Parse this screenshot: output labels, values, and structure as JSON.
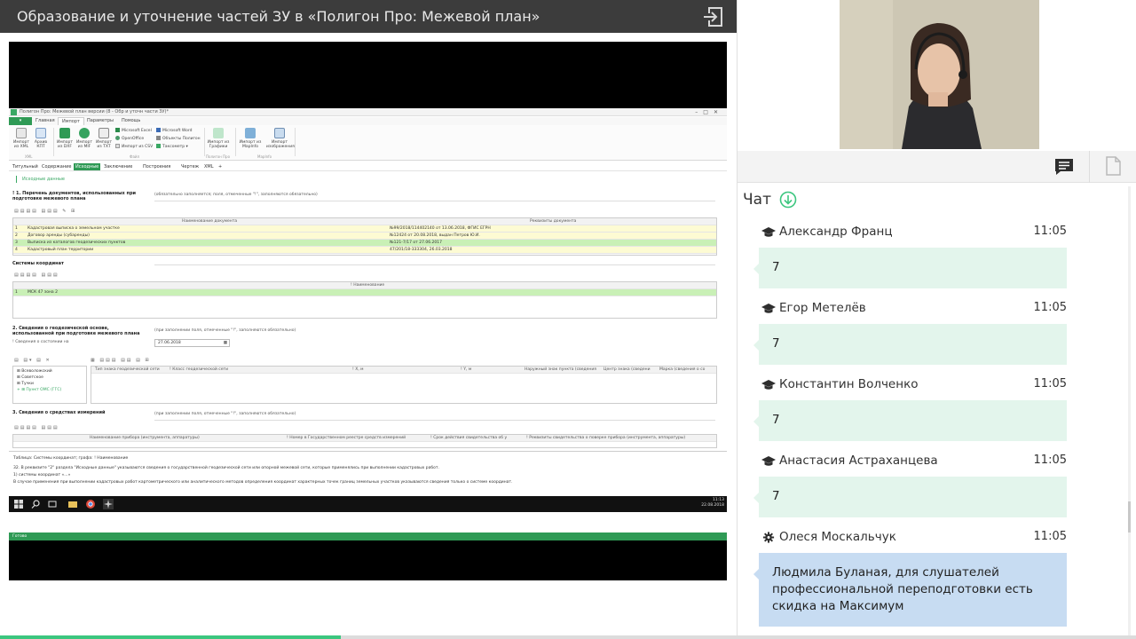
{
  "header": {
    "title": "Образование и уточнение частей ЗУ в «Полигон Про: Межевой план»",
    "exit_icon": "exit-icon"
  },
  "video": {
    "progress_fraction": 0.3,
    "screen": {
      "window_title": "Полигон Про: Межевой план версии (8 - Обр и уточн части ЗУ)*",
      "menu": [
        "Главная",
        "Импорт",
        "Параметры",
        "Помощь"
      ],
      "ribbon": {
        "buttons": [
          "Импорт из XML",
          "Архив КПТ",
          "Импорт из DXF",
          "Импорт из MIF",
          "Импорт из TXT",
          "Импорт из Графики",
          "Импорт из MapInfo",
          "Импорт изображения"
        ],
        "small": [
          "Microsoft Excel",
          "OpenOffice",
          "Импорт из CSV",
          "Microsoft Word",
          "Объекты Полигон",
          "Таксометр ▾"
        ],
        "groups": [
          "XML",
          "Файл",
          "Полигон Про",
          "MapInfo"
        ]
      },
      "tabs": [
        "Титульный",
        "Содержание",
        "Исходные",
        "Заключение",
        "Построения",
        "Чертеж",
        "XML",
        "+"
      ],
      "active_tab": "Исходные",
      "breadcrumb": "Исходные данные",
      "section1": {
        "heading": "! 1. Перечень документов, использованных при подготовке межевого плана",
        "note": "(обязательно заполняется; поля, отмеченные \"!\", заполняются обязательно)",
        "columns": [
          "Наименование документа",
          "Реквизиты документа"
        ],
        "rows": [
          {
            "n": "1",
            "name": "Кадастровая выписка о земельном участке",
            "req": "№99/2018/114402140 от 13.06.2018, ФГИС ЕГРН"
          },
          {
            "n": "2",
            "name": "Договор аренды (субаренды)",
            "req": "№12424 от 20.08.2018, выдан Петров Ю.И."
          },
          {
            "n": "3",
            "name": "Выписка из каталогов геодезических пунктов",
            "req": "№121-7/17 от 27.06.2017"
          },
          {
            "n": "4",
            "name": "Кадастровый план территории",
            "req": "47/201/18-333304, 26.03.2018"
          }
        ]
      },
      "coords": {
        "heading": "Системы координат",
        "column": "! Наименование",
        "rows": [
          {
            "n": "1",
            "name": "МСК 47 зона 2"
          }
        ]
      },
      "section2": {
        "heading": "2. Сведения о геодезической основе, использованной при подготовке межевого плана",
        "note": "(при заполнении поля, отмеченные \"!\", заполняются обязательно)",
        "date_label": "! Сведения о состоянии на",
        "date_value": "27.06.2018",
        "tree": [
          "Всеволожский",
          "Советское",
          "Тучки",
          "Пункт ОМС (ГГС)"
        ],
        "columns": [
          "Тип знака геодезической сети",
          "! Класс геодезической сети",
          "! X, м",
          "! Y, м",
          "Наружный знак пункта (сведения",
          "Центр знака (сведени",
          "Марка (сведения о со"
        ]
      },
      "section3": {
        "heading": "3. Сведения о средствах измерений",
        "note": "(при заполнении поля, отмеченные \"!\", заполняются обязательно)",
        "columns": [
          "Наименование прибора (инструмента, аппаратуры)",
          "! Номер в Государственном реестре средств измерений",
          "! Срок действия свидетельства об у",
          "! Реквизиты свидетельства о поверке прибора (инструмента, аппаратуры)"
        ]
      },
      "hint": [
        "Таблица: Системы координат; графа: ! Наименование",
        "32. В реквизите \"2\" раздела \"Исходные данные\" указываются сведения о государственной геодезической сети или опорной межевой сети, которые применялись при выполнении кадастровых работ.",
        "1) системы координат «...»",
        "В случае применения при выполнении кадастровых работ картометрического или аналитического методов определения координат характерных точек границ земельных участков указываются сведения только о системе координат."
      ],
      "status": "Готово",
      "clock_time": "11:13",
      "clock_date": "22.08.2018"
    }
  },
  "chat": {
    "title": "Чат",
    "messages": [
      {
        "author": "Александр Франц",
        "time": "11:05",
        "text": "7",
        "role": "student"
      },
      {
        "author": "Егор Метелёв",
        "time": "11:05",
        "text": "7",
        "role": "student"
      },
      {
        "author": "Константин Волченко",
        "time": "11:05",
        "text": "7",
        "role": "student"
      },
      {
        "author": "Анастасия Астраханцева",
        "time": "11:05",
        "text": "7",
        "role": "student"
      },
      {
        "author": "Олеся Москальчук",
        "time": "11:05",
        "text": "Людмила Буланая, для слушателей профессиональной переподготовки есть скидка на Максимум",
        "role": "admin"
      }
    ]
  },
  "colors": {
    "accent": "#3aa864",
    "bubble_student": "#e3f5ec",
    "bubble_admin": "#c7dcf2",
    "topbar": "#3c3c3c",
    "progress": "#3cc67f"
  }
}
